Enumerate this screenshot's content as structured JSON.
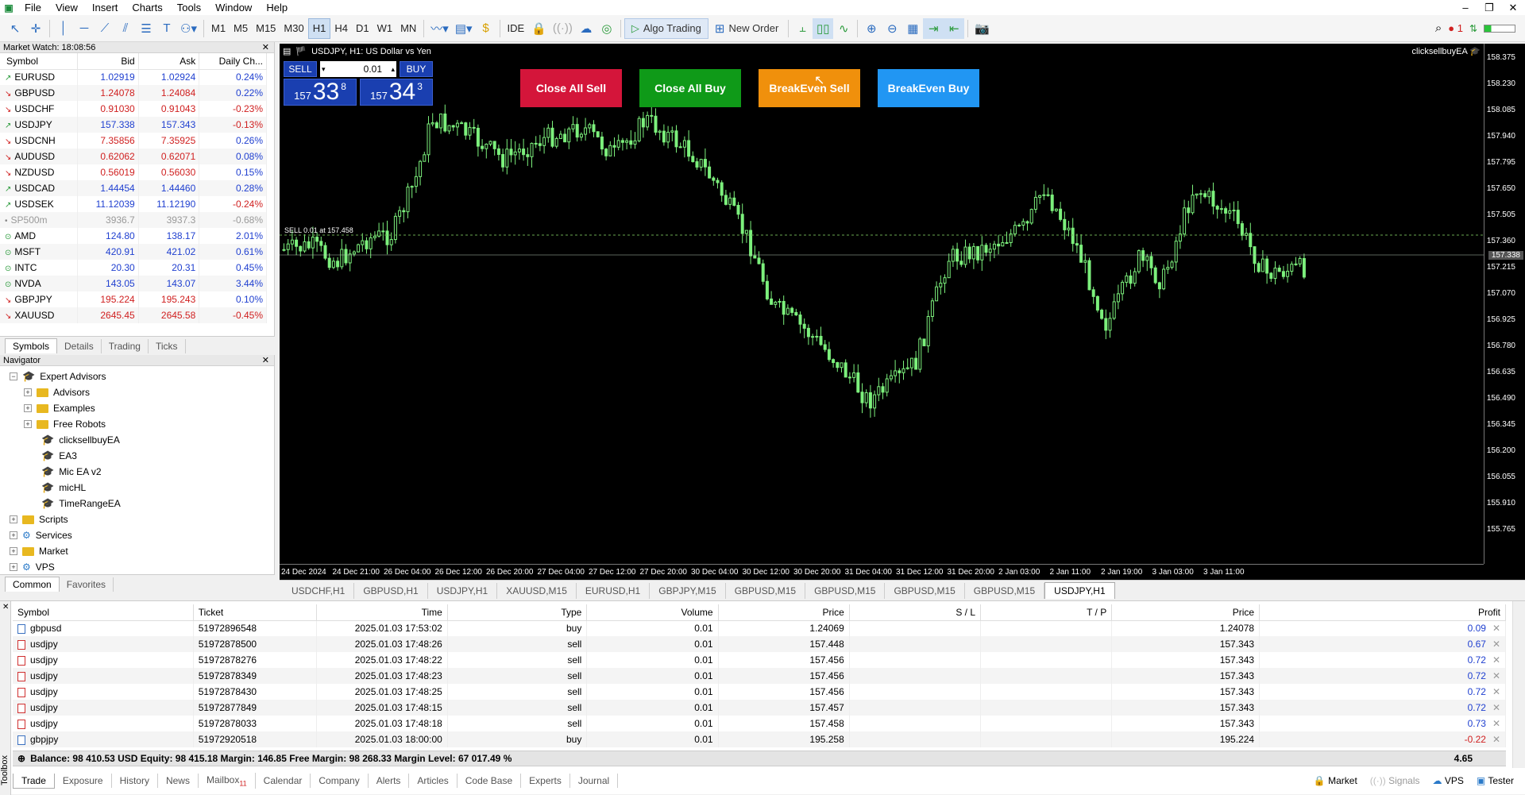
{
  "menu": [
    "File",
    "View",
    "Insert",
    "Charts",
    "Tools",
    "Window",
    "Help"
  ],
  "toolbar": {
    "timeframes": [
      "M1",
      "M5",
      "M15",
      "M30",
      "H1",
      "H4",
      "D1",
      "W1",
      "MN"
    ],
    "active_tf": "H1",
    "ide": "IDE",
    "algo_trading": "Algo Trading",
    "new_order": "New Order",
    "notif_count": "1"
  },
  "market_watch": {
    "title": "Market Watch: 18:08:56",
    "headers": [
      "Symbol",
      "Bid",
      "Ask",
      "Daily Ch..."
    ],
    "rows": [
      {
        "symbol": "EURUSD",
        "bid": "1.02919",
        "ask": "1.02924",
        "change": "0.24%",
        "dir": "up"
      },
      {
        "symbol": "GBPUSD",
        "bid": "1.24078",
        "ask": "1.24084",
        "change": "0.22%",
        "dir": "dn"
      },
      {
        "symbol": "USDCHF",
        "bid": "0.91030",
        "ask": "0.91043",
        "change": "-0.23%",
        "dir": "dn"
      },
      {
        "symbol": "USDJPY",
        "bid": "157.338",
        "ask": "157.343",
        "change": "-0.13%",
        "dir": "up"
      },
      {
        "symbol": "USDCNH",
        "bid": "7.35856",
        "ask": "7.35925",
        "change": "0.26%",
        "dir": "dn"
      },
      {
        "symbol": "AUDUSD",
        "bid": "0.62062",
        "ask": "0.62071",
        "change": "0.08%",
        "dir": "dn"
      },
      {
        "symbol": "NZDUSD",
        "bid": "0.56019",
        "ask": "0.56030",
        "change": "0.15%",
        "dir": "dn"
      },
      {
        "symbol": "USDCAD",
        "bid": "1.44454",
        "ask": "1.44460",
        "change": "0.28%",
        "dir": "up"
      },
      {
        "symbol": "USDSEK",
        "bid": "11.12039",
        "ask": "11.12190",
        "change": "-0.24%",
        "dir": "up"
      },
      {
        "symbol": "SP500m",
        "bid": "3936.7",
        "ask": "3937.3",
        "change": "-0.68%",
        "dir": "neu"
      },
      {
        "symbol": "AMD",
        "bid": "124.80",
        "ask": "138.17",
        "change": "2.01%",
        "dir": "stock"
      },
      {
        "symbol": "MSFT",
        "bid": "420.91",
        "ask": "421.02",
        "change": "0.61%",
        "dir": "stock"
      },
      {
        "symbol": "INTC",
        "bid": "20.30",
        "ask": "20.31",
        "change": "0.45%",
        "dir": "stock"
      },
      {
        "symbol": "NVDA",
        "bid": "143.05",
        "ask": "143.07",
        "change": "3.44%",
        "dir": "stock"
      },
      {
        "symbol": "GBPJPY",
        "bid": "195.224",
        "ask": "195.243",
        "change": "0.10%",
        "dir": "dn"
      },
      {
        "symbol": "XAUUSD",
        "bid": "2645.45",
        "ask": "2645.58",
        "change": "-0.45%",
        "dir": "dn"
      }
    ],
    "tabs": [
      "Symbols",
      "Details",
      "Trading",
      "Ticks"
    ]
  },
  "navigator": {
    "title": "Navigator",
    "items": [
      {
        "label": "Expert Advisors",
        "level": 0,
        "kind": "ea-root"
      },
      {
        "label": "Advisors",
        "level": 1,
        "kind": "folder"
      },
      {
        "label": "Examples",
        "level": 1,
        "kind": "folder"
      },
      {
        "label": "Free Robots",
        "level": 1,
        "kind": "folder"
      },
      {
        "label": "clicksellbuyEA",
        "level": 2,
        "kind": "ea"
      },
      {
        "label": "EA3",
        "level": 2,
        "kind": "ea"
      },
      {
        "label": "Mic EA v2",
        "level": 2,
        "kind": "ea"
      },
      {
        "label": "micHL",
        "level": 2,
        "kind": "ea"
      },
      {
        "label": "TimeRangeEA",
        "level": 2,
        "kind": "ea"
      },
      {
        "label": "Scripts",
        "level": 0,
        "kind": "folder"
      },
      {
        "label": "Services",
        "level": 0,
        "kind": "svc"
      },
      {
        "label": "Market",
        "level": 0,
        "kind": "folder"
      },
      {
        "label": "VPS",
        "level": 0,
        "kind": "svc"
      }
    ],
    "tabs": [
      "Common",
      "Favorites"
    ]
  },
  "chart": {
    "header": "USDJPY, H1:  US Dollar vs Yen",
    "ea_name": "clicksellbuyEA",
    "trade_panel": {
      "sell": "SELL",
      "buy": "BUY",
      "lot": "0.01",
      "bid_small": "157",
      "bid_big": "33",
      "bid_pip": "8",
      "ask_small": "157",
      "ask_big": "34",
      "ask_pip": "3"
    },
    "buttons": [
      {
        "label": "Close All Sell",
        "color": "#d4153a"
      },
      {
        "label": "Close All Buy",
        "color": "#0f9a18"
      },
      {
        "label": "BreakEven Sell",
        "color": "#f0900c"
      },
      {
        "label": "BreakEven Buy",
        "color": "#2196f3"
      }
    ],
    "sell_line_label": "SELL 0.01 at 157.458",
    "price_ticks": [
      "158.375",
      "158.230",
      "158.085",
      "157.940",
      "157.795",
      "157.650",
      "157.505",
      "157.360",
      "157.215",
      "157.070",
      "156.925",
      "156.780",
      "156.635",
      "156.490",
      "156.345",
      "156.200",
      "156.055",
      "155.910",
      "155.765"
    ],
    "current_price": "157.338",
    "time_ticks": [
      "24 Dec 2024",
      "24 Dec 21:00",
      "26 Dec 04:00",
      "26 Dec 12:00",
      "26 Dec 20:00",
      "27 Dec 04:00",
      "27 Dec 12:00",
      "27 Dec 20:00",
      "30 Dec 04:00",
      "30 Dec 12:00",
      "30 Dec 20:00",
      "31 Dec 04:00",
      "31 Dec 12:00",
      "31 Dec 20:00",
      "2 Jan 03:00",
      "2 Jan 11:00",
      "2 Jan 19:00",
      "3 Jan 03:00",
      "3 Jan 11:00"
    ]
  },
  "chart_tabs": [
    "USDCHF,H1",
    "GBPUSD,H1",
    "USDJPY,H1",
    "XAUUSD,M15",
    "EURUSD,H1",
    "GBPJPY,M15",
    "GBPUSD,M15",
    "GBPUSD,M15",
    "GBPUSD,M15",
    "GBPUSD,M15",
    "USDJPY,H1"
  ],
  "active_chart_tab": 10,
  "trade": {
    "headers": [
      "Symbol",
      "Ticket",
      "Time",
      "Type",
      "Volume",
      "Price",
      "S / L",
      "T / P",
      "Price",
      "Profit"
    ],
    "rows": [
      {
        "symbol": "gbpusd",
        "ticket": "51972896548",
        "time": "2025.01.03 17:53:02",
        "type": "buy",
        "volume": "0.01",
        "price": "1.24069",
        "sl": "",
        "tp": "",
        "cur": "1.24078",
        "profit": "0.09"
      },
      {
        "symbol": "usdjpy",
        "ticket": "51972878500",
        "time": "2025.01.03 17:48:26",
        "type": "sell",
        "volume": "0.01",
        "price": "157.448",
        "sl": "",
        "tp": "",
        "cur": "157.343",
        "profit": "0.67"
      },
      {
        "symbol": "usdjpy",
        "ticket": "51972878276",
        "time": "2025.01.03 17:48:22",
        "type": "sell",
        "volume": "0.01",
        "price": "157.456",
        "sl": "",
        "tp": "",
        "cur": "157.343",
        "profit": "0.72"
      },
      {
        "symbol": "usdjpy",
        "ticket": "51972878349",
        "time": "2025.01.03 17:48:23",
        "type": "sell",
        "volume": "0.01",
        "price": "157.456",
        "sl": "",
        "tp": "",
        "cur": "157.343",
        "profit": "0.72"
      },
      {
        "symbol": "usdjpy",
        "ticket": "51972878430",
        "time": "2025.01.03 17:48:25",
        "type": "sell",
        "volume": "0.01",
        "price": "157.456",
        "sl": "",
        "tp": "",
        "cur": "157.343",
        "profit": "0.72"
      },
      {
        "symbol": "usdjpy",
        "ticket": "51972877849",
        "time": "2025.01.03 17:48:15",
        "type": "sell",
        "volume": "0.01",
        "price": "157.457",
        "sl": "",
        "tp": "",
        "cur": "157.343",
        "profit": "0.72"
      },
      {
        "symbol": "usdjpy",
        "ticket": "51972878033",
        "time": "2025.01.03 17:48:18",
        "type": "sell",
        "volume": "0.01",
        "price": "157.458",
        "sl": "",
        "tp": "",
        "cur": "157.343",
        "profit": "0.73"
      },
      {
        "symbol": "gbpjpy",
        "ticket": "51972920518",
        "time": "2025.01.03 18:00:00",
        "type": "buy",
        "volume": "0.01",
        "price": "195.258",
        "sl": "",
        "tp": "",
        "cur": "195.224",
        "profit": "-0.22"
      }
    ],
    "balance_line": "Balance: 98 410.53 USD  Equity: 98 415.18  Margin: 146.85  Free Margin: 98 268.33  Margin Level: 67 017.49 %",
    "total_profit": "4.65"
  },
  "toolbox": {
    "label": "Toolbox",
    "tabs": [
      "Trade",
      "Exposure",
      "History",
      "News",
      "Mailbox",
      "Calendar",
      "Company",
      "Alerts",
      "Articles",
      "Code Base",
      "Experts",
      "Journal"
    ],
    "mailbox_count": "11",
    "right": [
      "Market",
      "Signals",
      "VPS",
      "Tester"
    ]
  }
}
